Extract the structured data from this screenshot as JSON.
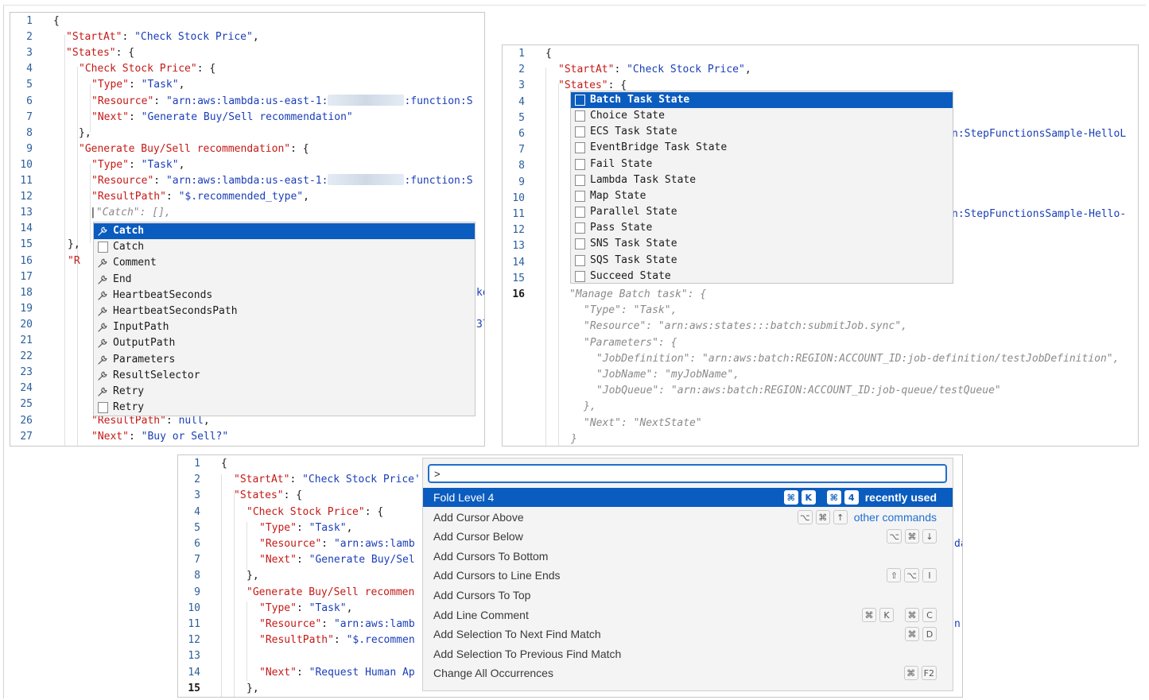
{
  "editor1": {
    "lines": [
      {
        "n": "1"
      },
      {
        "n": "2"
      },
      {
        "n": "3"
      },
      {
        "n": "4"
      },
      {
        "n": "5"
      },
      {
        "n": "6"
      },
      {
        "n": "7"
      },
      {
        "n": "8"
      },
      {
        "n": "9"
      },
      {
        "n": "10"
      },
      {
        "n": "11"
      },
      {
        "n": "12"
      },
      {
        "n": "13"
      },
      {
        "n": "14"
      },
      {
        "n": "15"
      },
      {
        "n": "16"
      },
      {
        "n": "17"
      },
      {
        "n": "18"
      },
      {
        "n": "19"
      },
      {
        "n": "20"
      },
      {
        "n": "21"
      },
      {
        "n": "22"
      },
      {
        "n": "23"
      },
      {
        "n": "24"
      },
      {
        "n": "25"
      },
      {
        "n": "26"
      },
      {
        "n": "27"
      }
    ],
    "code": {
      "l1": "{",
      "l2_key": "\"StartAt\"",
      "l2_val": "\"Check Stock Price\"",
      "l3_key": "\"States\"",
      "l4_key": "\"Check Stock Price\"",
      "l5_key": "\"Type\"",
      "l5_val": "\"Task\"",
      "l6_key": "\"Resource\"",
      "l6_val": "\"arn:aws:lambda:us-east-1:",
      "l6_tail": ":function:S",
      "l7_key": "\"Next\"",
      "l7_val": "\"Generate Buy/Sell recommendation\"",
      "l8": "},",
      "l9_key": "\"Generate Buy/Sell recommendation\"",
      "l10_key": "\"Type\"",
      "l10_val": "\"Task\"",
      "l11_key": "\"Resource\"",
      "l11_val": "\"arn:aws:lambda:us-east-1:",
      "l11_tail": ":function:S",
      "l12_key": "\"ResultPath\"",
      "l12_val": "\"$.recommended_type\"",
      "l13_ghost": "\"Catch\": [],",
      "l15_frag": "},",
      "l16_frag": "\"R",
      "l18_frag": "ke",
      "l20_frag": "37",
      "l26_key": "\"ResultPath\"",
      "l26_val": "null",
      "l27_key": "\"Next\"",
      "l27_val": "\"Buy or Sell?\""
    },
    "suggest": [
      {
        "label": "Catch",
        "icon": "wrench-icon",
        "selected": true
      },
      {
        "label": "Catch",
        "icon": "snippet-box-icon"
      },
      {
        "label": "Comment",
        "icon": "wrench-icon"
      },
      {
        "label": "End",
        "icon": "wrench-icon"
      },
      {
        "label": "HeartbeatSeconds",
        "icon": "wrench-icon"
      },
      {
        "label": "HeartbeatSecondsPath",
        "icon": "wrench-icon"
      },
      {
        "label": "InputPath",
        "icon": "wrench-icon"
      },
      {
        "label": "OutputPath",
        "icon": "wrench-icon"
      },
      {
        "label": "Parameters",
        "icon": "wrench-icon"
      },
      {
        "label": "ResultSelector",
        "icon": "wrench-icon"
      },
      {
        "label": "Retry",
        "icon": "wrench-icon"
      },
      {
        "label": "Retry",
        "icon": "snippet-box-icon"
      }
    ]
  },
  "editor2": {
    "lines": [
      {
        "n": "1"
      },
      {
        "n": "2"
      },
      {
        "n": "3"
      },
      {
        "n": "4"
      },
      {
        "n": "5"
      },
      {
        "n": "6"
      },
      {
        "n": "7"
      },
      {
        "n": "8"
      },
      {
        "n": "9"
      },
      {
        "n": "10"
      },
      {
        "n": "11"
      },
      {
        "n": "12"
      },
      {
        "n": "13"
      },
      {
        "n": "14"
      },
      {
        "n": "15"
      },
      {
        "n": "16"
      }
    ],
    "code": {
      "l1": "{",
      "l2_key": "\"StartAt\"",
      "l2_val": "\"Check Stock Price\"",
      "l3_key": "\"States\"",
      "l6_frag": "n:StepFunctionsSample-HelloL",
      "l11_frag": "n:StepFunctionsSample-Hello-",
      "g16": "\"Manage Batch task\": {",
      "g17": "\"Type\": \"Task\",",
      "g18": "\"Resource\": \"arn:aws:states:::batch:submitJob.sync\",",
      "g19": "\"Parameters\": {",
      "g20": "\"JobDefinition\": \"arn:aws:batch:REGION:ACCOUNT_ID:job-definition/testJobDefinition\",",
      "g21": "\"JobName\": \"myJobName\",",
      "g22": "\"JobQueue\": \"arn:aws:batch:REGION:ACCOUNT_ID:job-queue/testQueue\"",
      "g23": "},",
      "g24": "\"Next\": \"NextState\"",
      "g25": "}"
    },
    "suggest": [
      {
        "label": "Batch Task State",
        "selected": true
      },
      {
        "label": "Choice State"
      },
      {
        "label": "ECS Task State"
      },
      {
        "label": "EventBridge Task State"
      },
      {
        "label": "Fail State"
      },
      {
        "label": "Lambda Task State"
      },
      {
        "label": "Map State"
      },
      {
        "label": "Parallel State"
      },
      {
        "label": "Pass State"
      },
      {
        "label": "SNS Task State"
      },
      {
        "label": "SQS Task State"
      },
      {
        "label": "Succeed State"
      }
    ]
  },
  "editor3": {
    "lines": [
      {
        "n": "1"
      },
      {
        "n": "2"
      },
      {
        "n": "3"
      },
      {
        "n": "4"
      },
      {
        "n": "5"
      },
      {
        "n": "6"
      },
      {
        "n": "7"
      },
      {
        "n": "8"
      },
      {
        "n": "9"
      },
      {
        "n": "10"
      },
      {
        "n": "11"
      },
      {
        "n": "12"
      },
      {
        "n": "13"
      },
      {
        "n": "14"
      },
      {
        "n": "15"
      }
    ],
    "code": {
      "l1": "{",
      "l2_key": "\"StartAt\"",
      "l2_val": "\"Check Stock Price'",
      "l3_key": "\"States\"",
      "l4_key": "\"Check Stock Price\"",
      "l5_key": "\"Type\"",
      "l5_val": "\"Task\"",
      "l6_key": "\"Resource\"",
      "l6_val": "\"arn:aws:lamb",
      "l7_key": "\"Next\"",
      "l7_val": "\"Generate Buy/Sel",
      "l8": "},",
      "l9_key": "\"Generate Buy/Sell recommen",
      "l10_key": "\"Type\"",
      "l10_val": "\"Task\"",
      "l11_key": "\"Resource\"",
      "l11_val": "\"arn:aws:lamb",
      "l12_key": "\"ResultPath\"",
      "l12_val": "\"$.recommen",
      "l14_key": "\"Next\"",
      "l14_val": "\"Request Human Ap",
      "l15": "},",
      "l6_frag": "da",
      "l11_frag": "n"
    },
    "palette": {
      "input_value": ">",
      "rows": [
        {
          "label": "Fold Level 4",
          "keys": [
            [
              "⌘",
              "K"
            ],
            [
              "⌘",
              "4"
            ]
          ],
          "tag": "recently used",
          "selected": true
        },
        {
          "label": "Add Cursor Above",
          "keys": [
            [
              "⌥",
              "⌘",
              "↑"
            ]
          ],
          "tag": "other commands",
          "link": true
        },
        {
          "label": "Add Cursor Below",
          "keys": [
            [
              "⌥",
              "⌘",
              "↓"
            ]
          ]
        },
        {
          "label": "Add Cursors To Bottom",
          "keys": []
        },
        {
          "label": "Add Cursors to Line Ends",
          "keys": [
            [
              "⇧",
              "⌥",
              "I"
            ]
          ]
        },
        {
          "label": "Add Cursors To Top",
          "keys": []
        },
        {
          "label": "Add Line Comment",
          "keys": [
            [
              "⌘",
              "K"
            ],
            [
              "⌘",
              "C"
            ]
          ]
        },
        {
          "label": "Add Selection To Next Find Match",
          "keys": [
            [
              "⌘",
              "D"
            ]
          ]
        },
        {
          "label": "Add Selection To Previous Find Match",
          "keys": []
        },
        {
          "label": "Change All Occurrences",
          "keys": [
            [
              "⌘",
              "F2"
            ]
          ]
        }
      ]
    }
  },
  "colors": {
    "accent": "#0b5cbf",
    "key": "#c41a16",
    "string": "#1a3eb8",
    "gutter": "#2b5f9c"
  }
}
